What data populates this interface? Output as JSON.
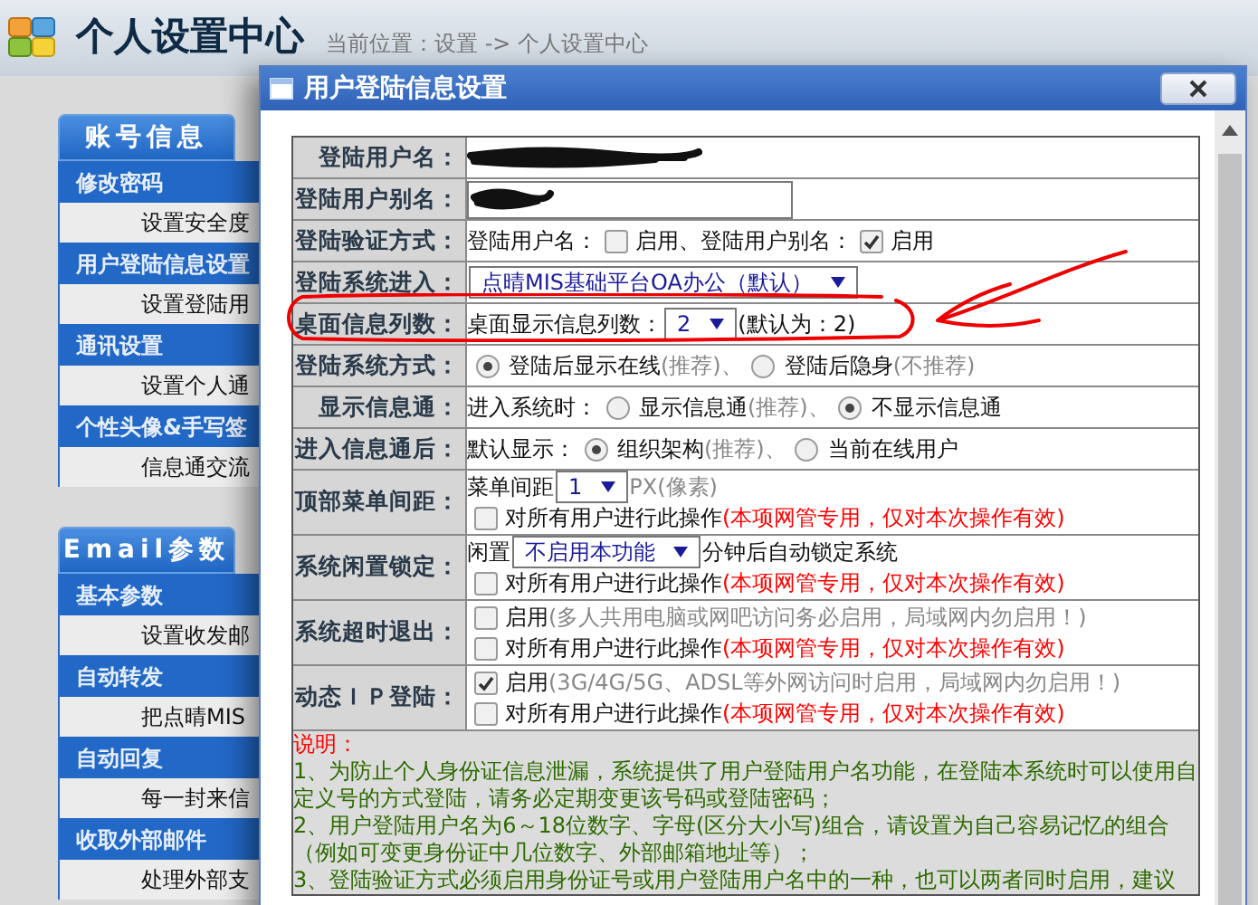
{
  "header": {
    "title": "个人设置中心",
    "breadcrumb": "当前位置：设置 -> 个人设置中心"
  },
  "sidebar": [
    {
      "tab": "账号信息",
      "groups": [
        {
          "heading": "修改密码",
          "item": "设置安全度"
        },
        {
          "heading": "用户登陆信息设置",
          "item": "设置登陆用"
        },
        {
          "heading": "通讯设置",
          "item": "设置个人通"
        },
        {
          "heading": "个性头像&手写签",
          "item": "信息通交流"
        }
      ]
    },
    {
      "tab": "Email参数",
      "groups": [
        {
          "heading": "基本参数",
          "item": "设置收发邮"
        },
        {
          "heading": "自动转发",
          "item": "把点晴MIS"
        },
        {
          "heading": "自动回复",
          "item": "每一封来信"
        },
        {
          "heading": "收取外部邮件",
          "item": "处理外部支"
        }
      ]
    }
  ],
  "dialog": {
    "title": "用户登陆信息设置",
    "rows": [
      {
        "label": "登陆用户名：",
        "lines": [
          [
            {
              "kind": "redacted"
            }
          ]
        ]
      },
      {
        "label": "登陆用户别名：",
        "lines": [
          [
            {
              "kind": "redacted_input"
            }
          ]
        ]
      },
      {
        "label": "登陆验证方式：",
        "lines": [
          [
            {
              "kind": "text",
              "text": "登陆用户名："
            },
            {
              "kind": "checkbox",
              "checked": false
            },
            {
              "kind": "text",
              "text": "启用、"
            },
            {
              "kind": "text",
              "text": "登陆用户别名："
            },
            {
              "kind": "checkbox",
              "checked": true
            },
            {
              "kind": "text",
              "text": "启用"
            }
          ]
        ]
      },
      {
        "label": "登陆系统进入：",
        "lines": [
          [
            {
              "kind": "select",
              "value": "点晴MIS基础平台OA办公（默认）"
            }
          ]
        ]
      },
      {
        "label": "桌面信息列数：",
        "lines": [
          [
            {
              "kind": "text",
              "text": "桌面显示信息列数："
            },
            {
              "kind": "select",
              "value": "2"
            },
            {
              "kind": "text",
              "text": "(默认为：2)"
            }
          ]
        ]
      },
      {
        "label": "登陆系统方式：",
        "lines": [
          [
            {
              "kind": "radio",
              "selected": true
            },
            {
              "kind": "text",
              "text": "登陆后显示在线"
            },
            {
              "kind": "hint",
              "text": "(推荐)、"
            },
            {
              "kind": "radio",
              "selected": false
            },
            {
              "kind": "text",
              "text": "登陆后隐身"
            },
            {
              "kind": "hint",
              "text": "(不推荐)"
            }
          ]
        ]
      },
      {
        "label": "显示信息通：",
        "lines": [
          [
            {
              "kind": "text",
              "text": "进入系统时："
            },
            {
              "kind": "radio",
              "selected": false
            },
            {
              "kind": "text",
              "text": "显示信息通"
            },
            {
              "kind": "hint",
              "text": "(推荐)、"
            },
            {
              "kind": "radio",
              "selected": true
            },
            {
              "kind": "text",
              "text": "不显示信息通"
            }
          ]
        ]
      },
      {
        "label": "进入信息通后：",
        "lines": [
          [
            {
              "kind": "text",
              "text": "默认显示："
            },
            {
              "kind": "radio",
              "selected": true
            },
            {
              "kind": "text",
              "text": "组织架构"
            },
            {
              "kind": "hint",
              "text": "(推荐)、"
            },
            {
              "kind": "radio",
              "selected": false
            },
            {
              "kind": "text",
              "text": "当前在线用户"
            }
          ]
        ]
      },
      {
        "label": "顶部菜单间距：",
        "lines": [
          [
            {
              "kind": "text",
              "text": "菜单间距"
            },
            {
              "kind": "select",
              "value": "1"
            },
            {
              "kind": "hint",
              "text": "PX(像素)"
            }
          ],
          [
            {
              "kind": "checkbox",
              "checked": false
            },
            {
              "kind": "text",
              "text": "对所有用户进行此操作"
            },
            {
              "kind": "warning",
              "text": "(本项网管专用，仅对本次操作有效)"
            }
          ]
        ]
      },
      {
        "label": "系统闲置锁定：",
        "lines": [
          [
            {
              "kind": "text",
              "text": "闲置"
            },
            {
              "kind": "select",
              "value": "不启用本功能"
            },
            {
              "kind": "text",
              "text": "分钟后自动锁定系统"
            }
          ],
          [
            {
              "kind": "checkbox",
              "checked": false
            },
            {
              "kind": "text",
              "text": "对所有用户进行此操作"
            },
            {
              "kind": "warning",
              "text": "(本项网管专用，仅对本次操作有效)"
            }
          ]
        ]
      },
      {
        "label": "系统超时退出：",
        "lines": [
          [
            {
              "kind": "checkbox",
              "checked": false
            },
            {
              "kind": "text",
              "text": "启用"
            },
            {
              "kind": "hint",
              "text": "(多人共用电脑或网吧访问务必启用，局域网内勿启用！)"
            }
          ],
          [
            {
              "kind": "checkbox",
              "checked": false
            },
            {
              "kind": "text",
              "text": "对所有用户进行此操作"
            },
            {
              "kind": "warning",
              "text": "(本项网管专用，仅对本次操作有效)"
            }
          ]
        ]
      },
      {
        "label": "动态ＩＰ登陆：",
        "lines": [
          [
            {
              "kind": "checkbox",
              "checked": true
            },
            {
              "kind": "text",
              "text": "启用"
            },
            {
              "kind": "hint",
              "text": "(3G/4G/5G、ADSL等外网访问时启用，局域网内勿启用！)"
            }
          ],
          [
            {
              "kind": "checkbox",
              "checked": false
            },
            {
              "kind": "text",
              "text": "对所有用户进行此操作"
            },
            {
              "kind": "warning",
              "text": "(本项网管专用，仅对本次操作有效)"
            }
          ]
        ]
      }
    ],
    "notes": {
      "heading": "说明：",
      "paragraphs": [
        "1、为防止个人身份证信息泄漏，系统提供了用户登陆用户名功能，在登陆本系统时可以使用自定义号的方式登陆，请务必定期变更该号码或登陆密码；",
        "2、用户登陆用户名为6～18位数字、字母(区分大小写)组合，请设置为自己容易记忆的组合（例如可变更身份证中几位数字、外部邮箱地址等）；",
        "3、登陆验证方式必须启用身份证号或用户登陆用户名中的一种，也可以两者同时启用，建议"
      ]
    }
  }
}
